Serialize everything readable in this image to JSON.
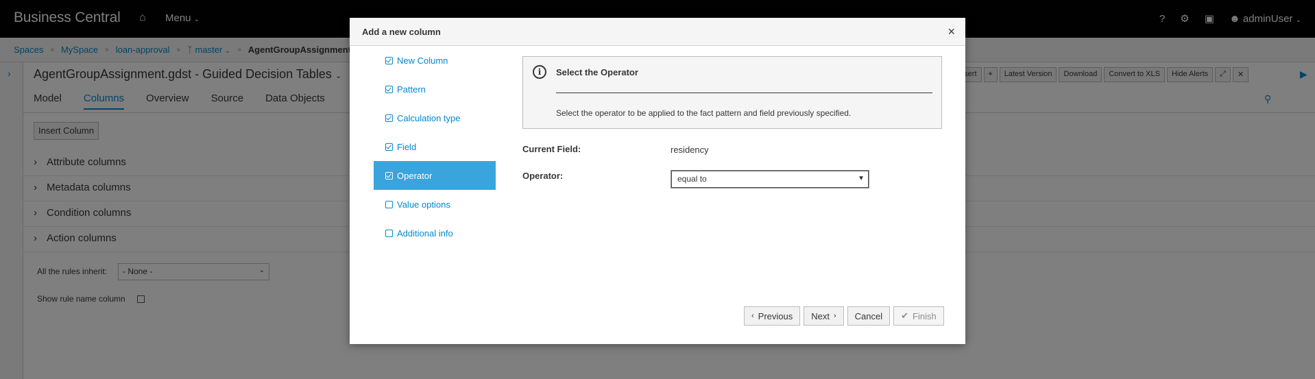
{
  "app": {
    "brand": "Business Central",
    "menu_label": "Menu",
    "user": "adminUser"
  },
  "breadcrumb": {
    "items": [
      "Spaces",
      "MySpace",
      "loan-approval",
      "master",
      "AgentGroupAssignment"
    ]
  },
  "editor": {
    "title": "AgentGroupAssignment.gdst - Guided Decision Tables",
    "toolbar": [
      "Insert",
      "Latest Version",
      "Download",
      "Convert to XLS",
      "Hide Alerts"
    ],
    "tabs": [
      "Model",
      "Columns",
      "Overview",
      "Source",
      "Data Objects"
    ],
    "active_tab": "Columns",
    "insert_column": "Insert Column",
    "accordions": [
      "Attribute columns",
      "Metadata columns",
      "Condition columns",
      "Action columns"
    ],
    "inherit_label": "All the rules inherit:",
    "inherit_value": "- None -",
    "rule_name_label": "Show rule name column"
  },
  "modal": {
    "title": "Add a new column",
    "close": "×",
    "steps": [
      {
        "label": "New Column",
        "done": true
      },
      {
        "label": "Pattern",
        "done": true
      },
      {
        "label": "Calculation type",
        "done": true
      },
      {
        "label": "Field",
        "done": true
      },
      {
        "label": "Operator",
        "done": true,
        "active": true
      },
      {
        "label": "Value options",
        "done": false
      },
      {
        "label": "Additional info",
        "done": false
      }
    ],
    "info_title": "Select the Operator",
    "info_desc": "Select the operator to be applied to the fact pattern and field previously specified.",
    "current_field_label": "Current Field:",
    "current_field_value": "residency",
    "operator_label": "Operator:",
    "operator_value": "equal to",
    "buttons": {
      "previous": "Previous",
      "next": "Next",
      "cancel": "Cancel",
      "finish": "Finish"
    }
  },
  "colors": {
    "accent": "#0088ce",
    "active_step": "#39a5dc",
    "topbar": "#030303"
  }
}
